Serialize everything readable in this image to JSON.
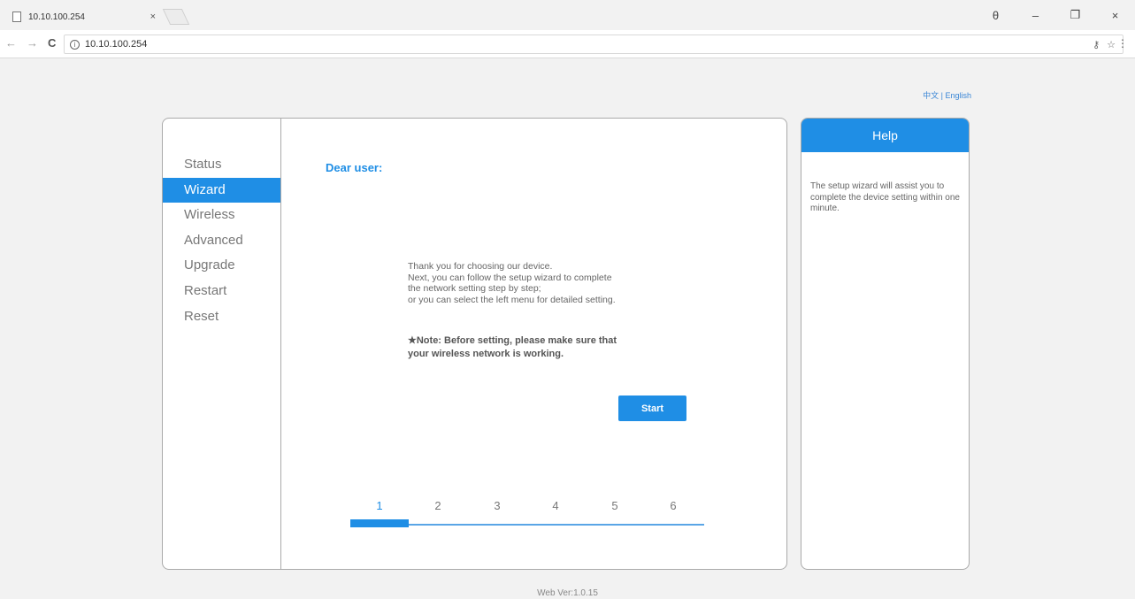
{
  "browser": {
    "tab_title": "10.10.100.254",
    "tab_close": "×",
    "url": "10.10.100.254",
    "window_controls": {
      "account": "θ",
      "minimize": "–",
      "restore": "❐",
      "close": "×"
    },
    "nav": {
      "back": "←",
      "forward": "→",
      "reload": "C"
    }
  },
  "language": {
    "chinese": "中文",
    "separator": " | ",
    "english": "English"
  },
  "sidebar": {
    "items": [
      {
        "label": "Status"
      },
      {
        "label": "Wizard"
      },
      {
        "label": "Wireless"
      },
      {
        "label": "Advanced"
      },
      {
        "label": "Upgrade"
      },
      {
        "label": "Restart"
      },
      {
        "label": "Reset"
      }
    ],
    "active_index": 1
  },
  "main": {
    "greeting": "Dear user:",
    "intro_lines": [
      "Thank you for choosing our device.",
      "Next, you can follow the setup wizard to complete",
      "the network setting step by step;",
      "or you can select the left menu for detailed setting."
    ],
    "note_line1": "★Note: Before setting, please make sure that",
    "note_line2": "your wireless network is working.",
    "start_label": "Start",
    "steps": [
      "1",
      "2",
      "3",
      "4",
      "5",
      "6"
    ],
    "current_step": 1
  },
  "help": {
    "title": "Help",
    "text": "The setup wizard will assist you to complete the device setting within one minute."
  },
  "footer": {
    "version": "Web Ver:1.0.15"
  },
  "colors": {
    "accent": "#1f8ee5",
    "link": "#3a86d6"
  }
}
